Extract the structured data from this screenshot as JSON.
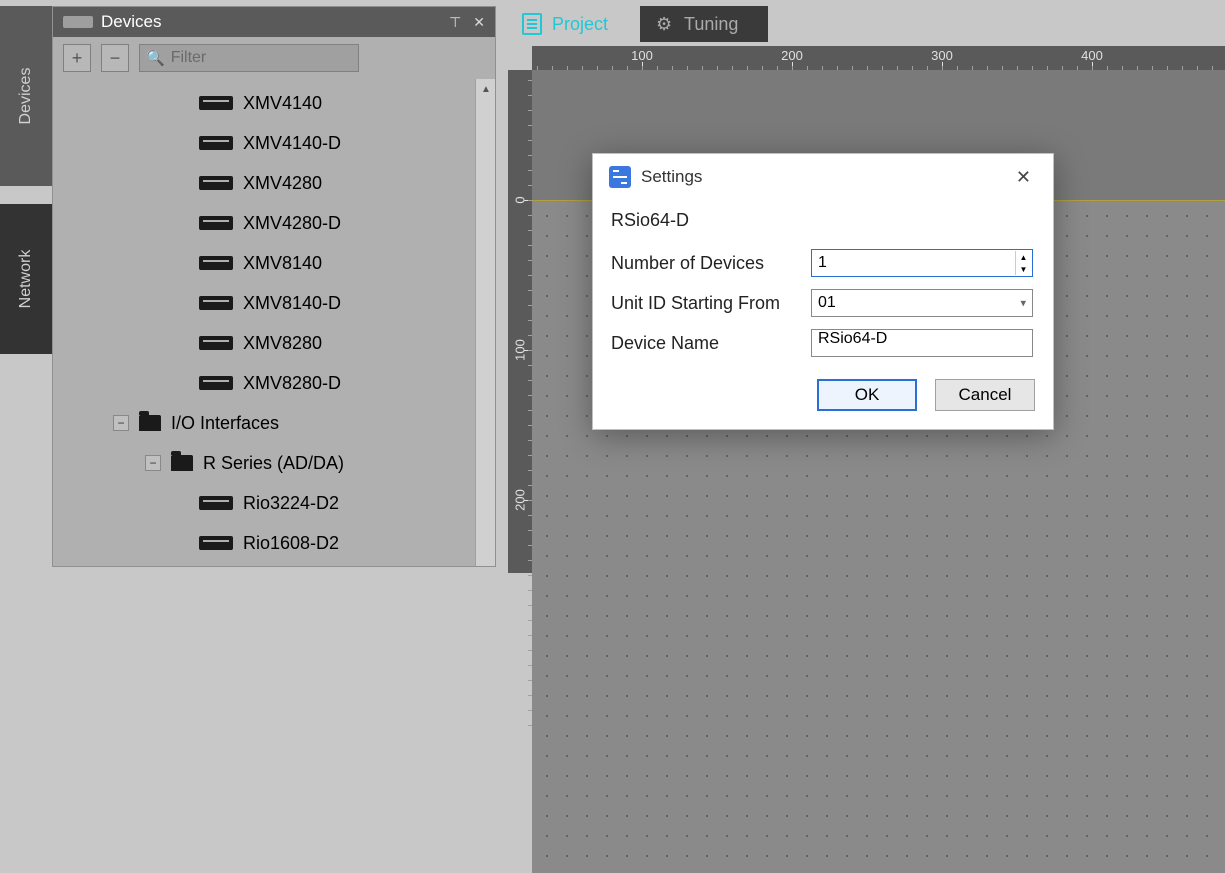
{
  "left_tabs": {
    "devices": "Devices",
    "network": "Network"
  },
  "devices_panel": {
    "title": "Devices",
    "filter_placeholder": "Filter",
    "items": [
      {
        "kind": "device",
        "label": "XMV4140"
      },
      {
        "kind": "device",
        "label": "XMV4140-D"
      },
      {
        "kind": "device",
        "label": "XMV4280"
      },
      {
        "kind": "device",
        "label": "XMV4280-D"
      },
      {
        "kind": "device",
        "label": "XMV8140"
      },
      {
        "kind": "device",
        "label": "XMV8140-D"
      },
      {
        "kind": "device",
        "label": "XMV8280"
      },
      {
        "kind": "device",
        "label": "XMV8280-D"
      },
      {
        "kind": "cat",
        "label": "I/O Interfaces"
      },
      {
        "kind": "subcat",
        "label": "R Series (AD/DA)"
      },
      {
        "kind": "device",
        "label": "Rio3224-D2"
      },
      {
        "kind": "device",
        "label": "Rio1608-D2"
      }
    ]
  },
  "tabs": {
    "project": "Project",
    "tuning": "Tuning"
  },
  "ruler": {
    "h_labels": [
      "100",
      "200",
      "300",
      "400"
    ],
    "v_labels": [
      "0",
      "100",
      "200"
    ]
  },
  "dialog": {
    "title": "Settings",
    "device": "RSio64-D",
    "fields": {
      "num_devices_label": "Number of Devices",
      "num_devices_value": "1",
      "unit_id_label": "Unit ID Starting From",
      "unit_id_value": "01",
      "device_name_label": "Device Name",
      "device_name_value": "RSio64-D"
    },
    "buttons": {
      "ok": "OK",
      "cancel": "Cancel"
    }
  }
}
